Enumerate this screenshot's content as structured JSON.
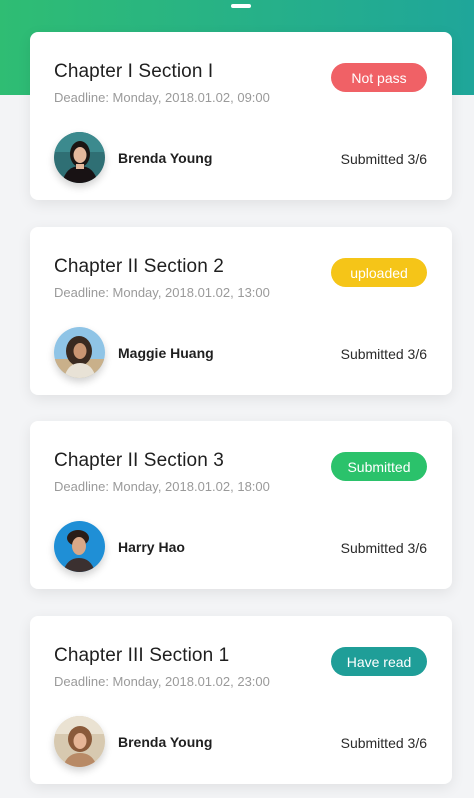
{
  "assignments": [
    {
      "title": "Chapter I  Section I",
      "deadline": "Deadline: Monday, 2018.01.02, 09:00",
      "status": {
        "label": "Not pass",
        "color": "#f06166"
      },
      "student": "Brenda Young",
      "submitted": "Submitted 3/6",
      "avatar_icon": "avatar-photo-icon"
    },
    {
      "title": "Chapter II Section 2",
      "deadline": "Deadline: Monday, 2018.01.02, 13:00",
      "status": {
        "label": "uploaded",
        "color": "#f5c518"
      },
      "student": "Maggie Huang",
      "submitted": "Submitted 3/6",
      "avatar_icon": "avatar-photo-icon"
    },
    {
      "title": "Chapter II Section 3",
      "deadline": "Deadline: Monday, 2018.01.02, 18:00",
      "status": {
        "label": "Submitted",
        "color": "#2bc26b"
      },
      "student": "Harry Hao",
      "submitted": "Submitted 3/6",
      "avatar_icon": "avatar-photo-icon"
    },
    {
      "title": "Chapter III Section 1",
      "deadline": "Deadline: Monday, 2018.01.02, 23:00",
      "status": {
        "label": "Have read",
        "color": "#1f9e98"
      },
      "student": "Brenda Young",
      "submitted": "Submitted 3/6",
      "avatar_icon": "avatar-photo-icon"
    }
  ],
  "header_gradient": [
    "#2fbd73",
    "#1fa69a"
  ]
}
